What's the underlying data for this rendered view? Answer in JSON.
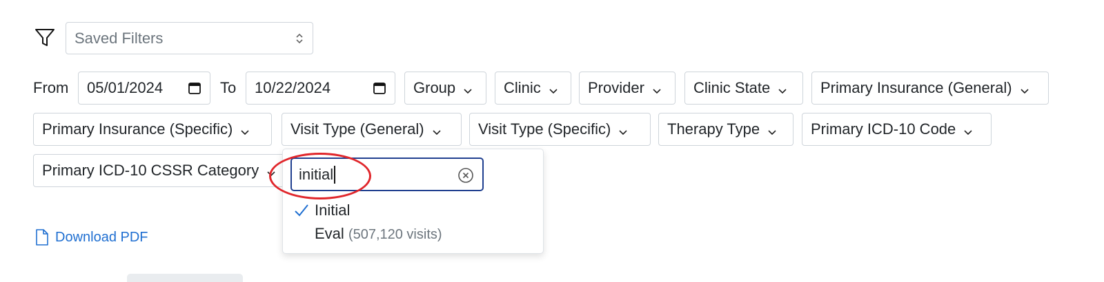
{
  "saved_filters": {
    "placeholder": "Saved Filters",
    "icon": "filter-icon"
  },
  "date_range": {
    "from_label": "From",
    "from_value": "05/01/2024",
    "to_label": "To",
    "to_value": "10/22/2024"
  },
  "filters": {
    "group": "Group",
    "clinic": "Clinic",
    "provider": "Provider",
    "clinic_state": "Clinic State",
    "primary_insurance_general": "Primary Insurance (General)",
    "primary_insurance_specific": "Primary Insurance (Specific)",
    "visit_type_general": "Visit Type (General)",
    "visit_type_specific": "Visit Type (Specific)",
    "therapy_type": "Therapy Type",
    "primary_icd10_code": "Primary ICD-10 Code",
    "primary_icd10_cssr_category": "Primary ICD-10 CSSR Category"
  },
  "dropdown": {
    "search_value": "initial",
    "options": [
      {
        "label": "Initial",
        "selected": true,
        "count": ""
      },
      {
        "label": "Eval",
        "selected": false,
        "count": "(507,120 visits)"
      }
    ]
  },
  "download": {
    "label": "Download PDF"
  },
  "colors": {
    "accent": "#1f6fd1",
    "focus_border": "#1f3f8f",
    "annotation": "#e0262b"
  }
}
